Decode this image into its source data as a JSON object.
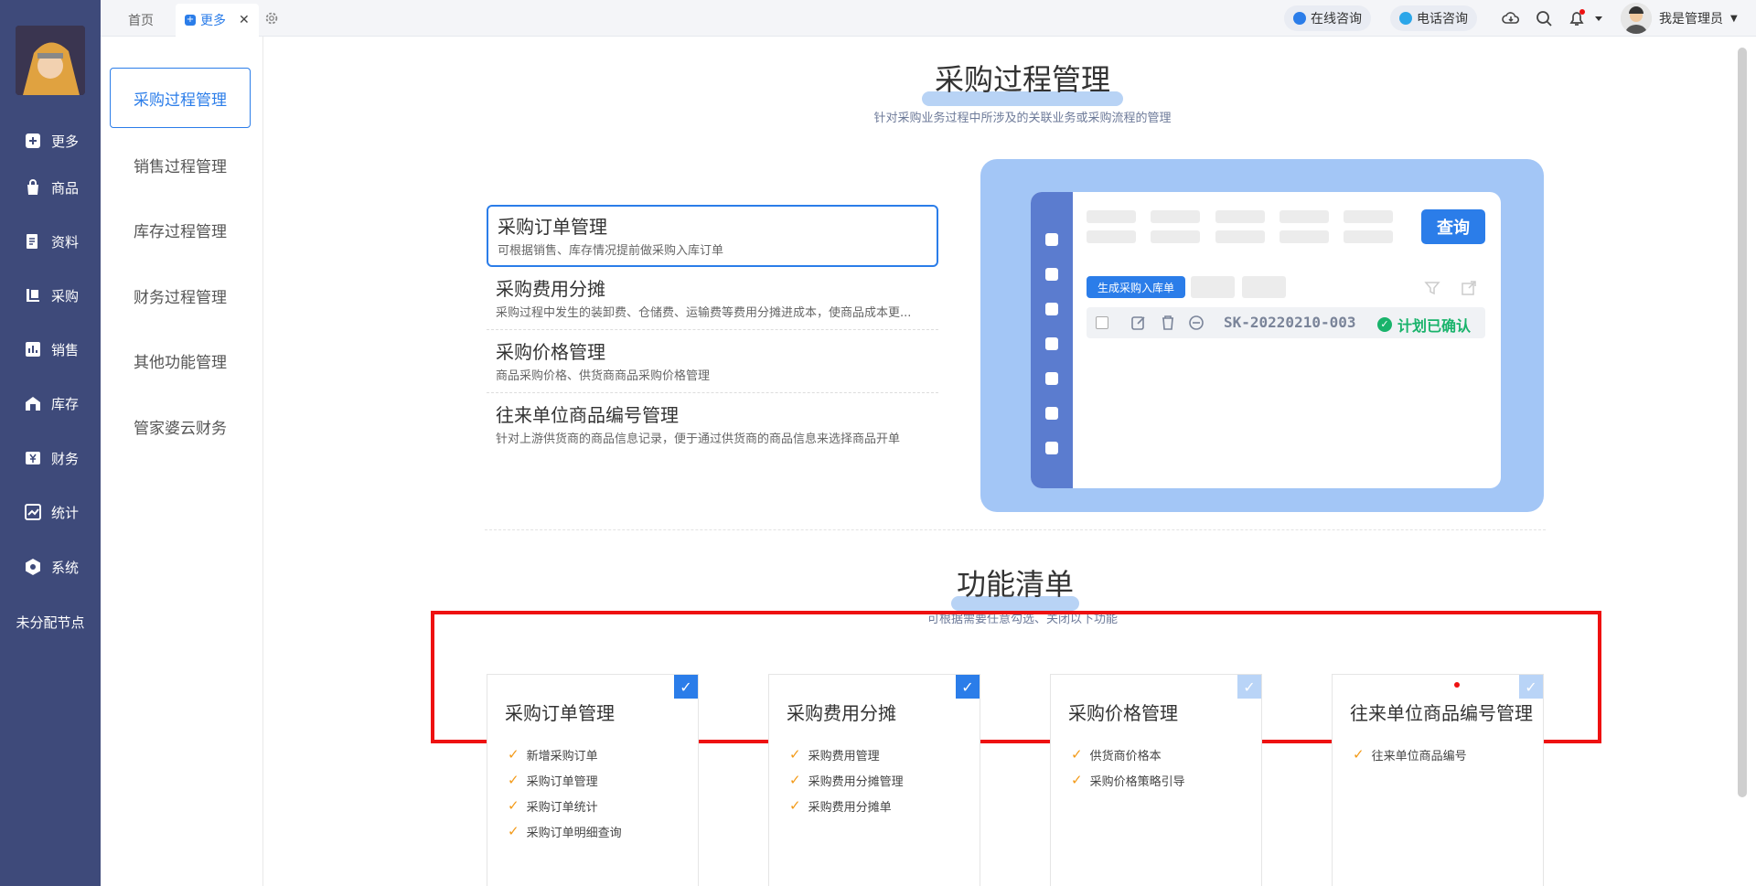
{
  "sidebar": {
    "items": [
      {
        "label": "更多",
        "icon": "plus-square-icon"
      },
      {
        "label": "商品",
        "icon": "bag-icon"
      },
      {
        "label": "资料",
        "icon": "document-icon"
      },
      {
        "label": "采购",
        "icon": "purchase-icon"
      },
      {
        "label": "销售",
        "icon": "bar-chart-icon"
      },
      {
        "label": "库存",
        "icon": "warehouse-icon"
      },
      {
        "label": "财务",
        "icon": "yuan-icon"
      },
      {
        "label": "统计",
        "icon": "trend-icon"
      },
      {
        "label": "系统",
        "icon": "hexagon-icon"
      }
    ],
    "unassigned": "未分配节点"
  },
  "topbar": {
    "tabs": [
      {
        "label": "首页"
      },
      {
        "label": "更多",
        "close": "✕"
      }
    ],
    "online": "在线咨询",
    "phone": "电话咨询",
    "user": "我是管理员"
  },
  "submenu": {
    "items": [
      "采购过程管理",
      "销售过程管理",
      "库存过程管理",
      "财务过程管理",
      "其他功能管理",
      "管家婆云财务"
    ]
  },
  "section1": {
    "title": "采购过程管理",
    "subtitle": "针对采购业务过程中所涉及的关联业务或采购流程的管理",
    "features": [
      {
        "title": "采购订单管理",
        "desc": "可根据销售、库存情况提前做采购入库订单"
      },
      {
        "title": "采购费用分摊",
        "desc": "采购过程中发生的装卸费、仓储费、运输费等费用分摊进成本，使商品成本更..."
      },
      {
        "title": "采购价格管理",
        "desc": "商品采购价格、供货商商品采购价格管理"
      },
      {
        "title": "往来单位商品编号管理",
        "desc": "针对上游供货商的商品信息记录，便于通过供货商的商品信息来选择商品开单"
      }
    ]
  },
  "illustration": {
    "query": "查询",
    "generate": "生成采购入库单",
    "order_no": "SK-20220210-003",
    "status": "计划已确认"
  },
  "section2": {
    "title": "功能清单",
    "subtitle": "可根据需要任意勾选、关闭以下功能",
    "cards": [
      {
        "title": "采购订单管理",
        "checked": true,
        "items": [
          "新增采购订单",
          "采购订单管理",
          "采购订单统计",
          "采购订单明细查询"
        ]
      },
      {
        "title": "采购费用分摊",
        "checked": true,
        "items": [
          "采购费用管理",
          "采购费用分摊管理",
          "采购费用分摊单"
        ]
      },
      {
        "title": "采购价格管理",
        "checked": false,
        "items": [
          "供货商价格本",
          "采购价格策略引导"
        ]
      },
      {
        "title": "往来单位商品编号管理",
        "checked": false,
        "items": [
          "往来单位商品编号"
        ]
      }
    ]
  },
  "colors": {
    "accent": "#2b7de9",
    "sidebar": "#3e4a7a",
    "check": "#f39b1a",
    "status": "#19b36b",
    "highlight": "#ee1111"
  }
}
